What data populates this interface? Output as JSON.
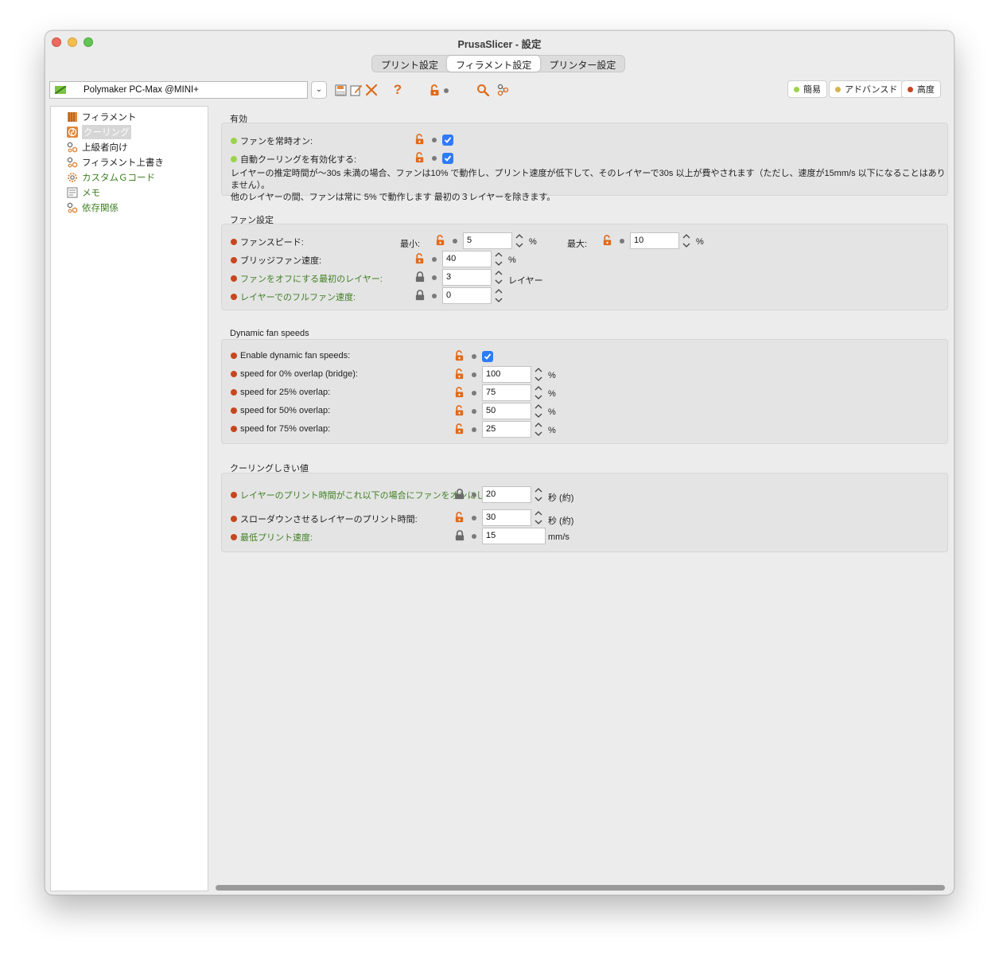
{
  "window": {
    "title": "PrusaSlicer - 設定"
  },
  "tabs": [
    "プリント設定",
    "フィラメント設定",
    "プリンター設定"
  ],
  "preset": {
    "name": "Polymaker PC-Max @MINI+"
  },
  "modes": [
    {
      "label": "簡易",
      "color": "#9bd34a"
    },
    {
      "label": "アドバンスド",
      "color": "#d9b24a"
    },
    {
      "label": "高度",
      "color": "#c6461f"
    }
  ],
  "sidebar": {
    "items": [
      {
        "label": "フィラメント"
      },
      {
        "label": "クーリング"
      },
      {
        "label": "上級者向け"
      },
      {
        "label": "フィラメント上書き"
      },
      {
        "label": "カスタムＧコード"
      },
      {
        "label": "メモ"
      },
      {
        "label": "依存関係"
      }
    ]
  },
  "sections": {
    "enable": {
      "title": "有効",
      "fan_always_on": "ファンを常時オン:",
      "auto_cooling": "自動クーリングを有効化する:",
      "desc1": "レイヤーの推定時間が〜30s 未満の場合、ファンは10% で動作し、プリント速度が低下して、そのレイヤーで30s 以上が費やされます（ただし、速度が15mm/s 以下になることはありません）。",
      "desc2": "他のレイヤーの間、ファンは常に 5% で動作します  最初の３レイヤーを除きます。"
    },
    "fan": {
      "title": "ファン設定",
      "fan_speed": "ファンスピード:",
      "min_label": "最小:",
      "min_value": "5",
      "max_label": "最大:",
      "max_value": "10",
      "bridge_label": "ブリッジファン速度:",
      "bridge_value": "40",
      "disable_first_label": "ファンをオフにする最初のレイヤー:",
      "disable_first_value": "3",
      "full_fan_label": "レイヤーでのフルファン速度:",
      "full_fan_value": "0",
      "unit_pct": "%",
      "unit_layer": "レイヤー"
    },
    "dynamic": {
      "title": "Dynamic fan speeds",
      "enable_label": "Enable dynamic fan speeds:",
      "rows": [
        {
          "label": "speed for 0% overlap (bridge):",
          "value": "100"
        },
        {
          "label": "speed for 25% overlap:",
          "value": "75"
        },
        {
          "label": "speed for 50% overlap:",
          "value": "50"
        },
        {
          "label": "speed for 75% overlap:",
          "value": "25"
        }
      ],
      "unit": "%"
    },
    "threshold": {
      "title": "クーリングしきい値",
      "fan_below_label": "レイヤーのプリント時間がこれ以下の場合にファンをオンにします:",
      "fan_below_value": "20",
      "slowdown_label": "スローダウンさせるレイヤーのプリント時間:",
      "slowdown_value": "30",
      "min_speed_label": "最低プリント速度:",
      "min_speed_value": "15",
      "unit_sec": "秒 (約)",
      "unit_mms": "mm/s"
    }
  }
}
